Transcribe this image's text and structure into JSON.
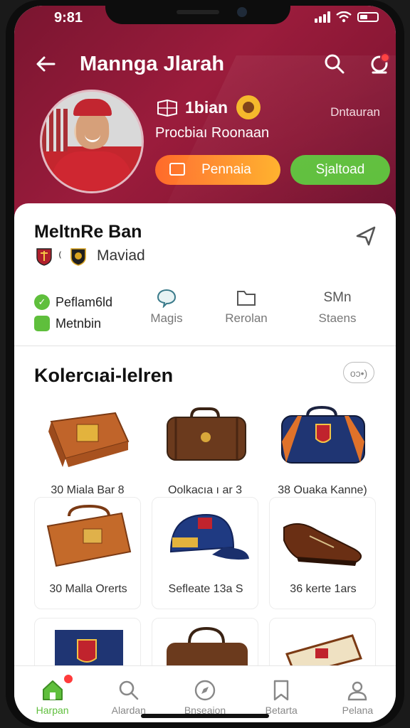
{
  "status": {
    "time": "9:81"
  },
  "header": {
    "title": "Mannga Jlarah",
    "player_name": "1bian",
    "league": "Dntauran",
    "player_sub": "Procbiaı Roonaan",
    "primary_button": "Pennaia",
    "secondary_button": "Sjaltoad"
  },
  "profile": {
    "name": "MeltnRe Ban",
    "club": "Maviad",
    "club_separator": "⁽",
    "stats": {
      "row1": "Peflam6ld",
      "row2": "Metnbin",
      "col1_label": "Magis",
      "col2_label": "Rerolan",
      "col3_top": "SMn",
      "col3_label": "Staens"
    }
  },
  "collection": {
    "title": "Kolercıai-lelren",
    "more_label": "oɔ•)",
    "items": [
      {
        "label": "30 Miala Bar 8"
      },
      {
        "label": "Oolkacıa ı ar 3"
      },
      {
        "label": "38 Ouaka Kanne)"
      },
      {
        "label": "30 Malla Orerts"
      },
      {
        "label": "Sefleate 13a S"
      },
      {
        "label": "36 kerte 1ars"
      }
    ]
  },
  "tabbar": {
    "tabs": [
      {
        "label": "Harpan"
      },
      {
        "label": "Alardan"
      },
      {
        "label": "Bnseaion"
      },
      {
        "label": "Betarta"
      },
      {
        "label": "Pelana"
      }
    ]
  },
  "colors": {
    "brand": "#9b1c3c",
    "accent_green": "#5fbf3c",
    "accent_orange": "#ff8a2a"
  }
}
